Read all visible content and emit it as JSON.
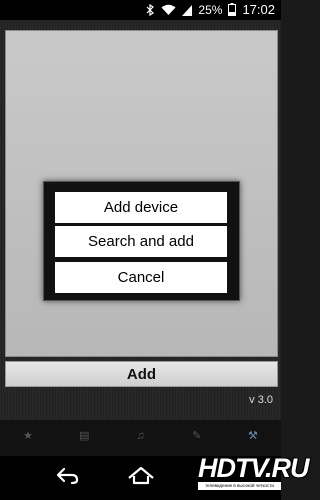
{
  "status_bar": {
    "battery": "25%",
    "time": "17:02"
  },
  "main": {
    "add_label": "Add",
    "version": "v 3.0"
  },
  "dialog": {
    "items": [
      "Add device",
      "Search and add",
      "Cancel"
    ]
  },
  "tabs": [
    {
      "icon": "star-icon"
    },
    {
      "icon": "list-icon"
    },
    {
      "icon": "music-icon"
    },
    {
      "icon": "pencil-icon"
    },
    {
      "icon": "settings-icon"
    }
  ],
  "watermark": {
    "brand": "HDTV.RU",
    "tagline": "телевидение в высокой четкости"
  }
}
